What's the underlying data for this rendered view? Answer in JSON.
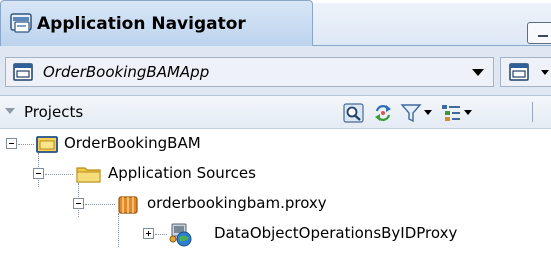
{
  "panel": {
    "title": "Application Navigator"
  },
  "app_selector": {
    "value": "OrderBookingBAMApp"
  },
  "projects_header": {
    "label": "Projects"
  },
  "tree": [
    {
      "label": "OrderBookingBAM",
      "icon": "project-folder-icon",
      "expanded": true
    },
    {
      "label": "Application Sources",
      "icon": "folder-icon",
      "expanded": true
    },
    {
      "label": "orderbookingbam.proxy",
      "icon": "package-icon",
      "expanded": true
    },
    {
      "label": "DataObjectOperationsByIDProxy",
      "icon": "web-service-proxy-icon",
      "expanded": false
    }
  ],
  "colors": {
    "tab_gradient_top": "#d8e6f6",
    "tab_gradient_bottom": "#bcd3ee",
    "toolbar_background": "#dfe7f3",
    "folder_yellow": "#f2c94c",
    "package_orange": "#e08a2a"
  }
}
